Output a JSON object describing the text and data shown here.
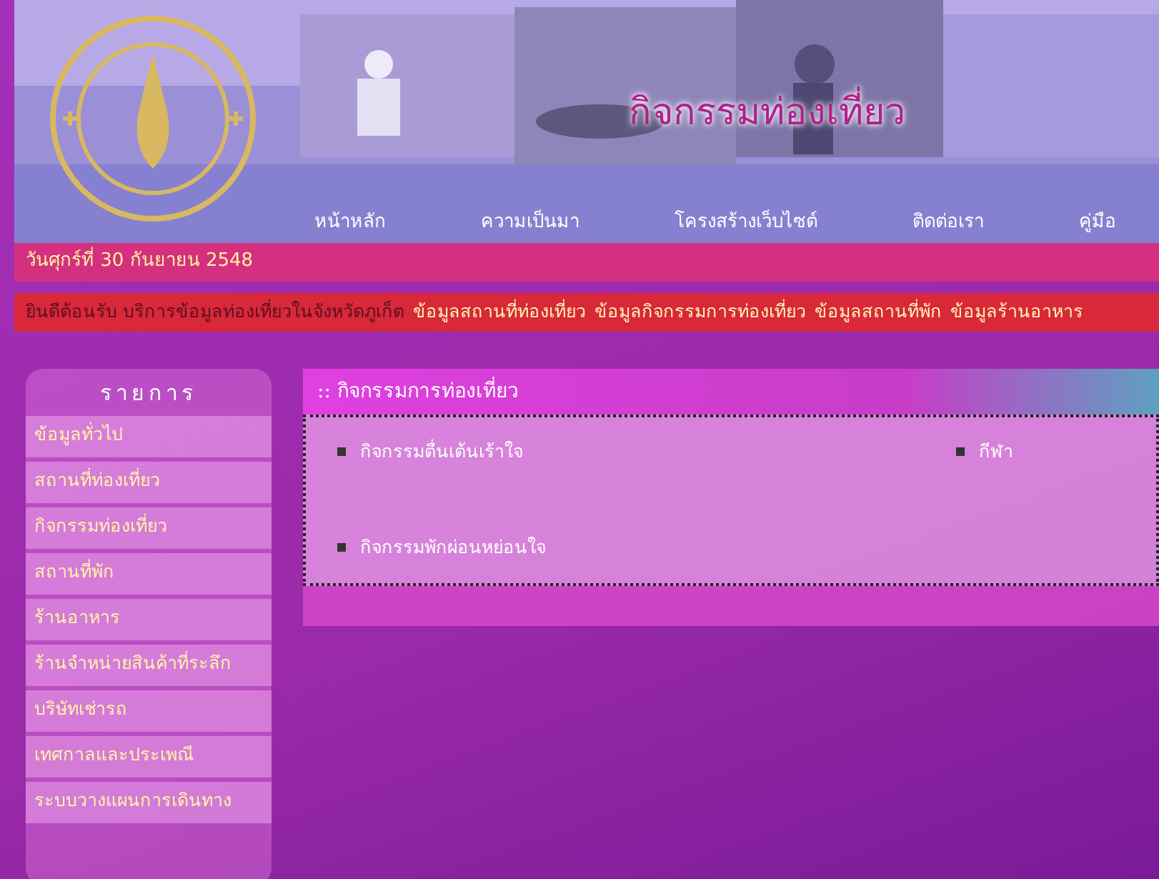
{
  "header": {
    "title": "กิจกรรมท่องเที่ยว",
    "nav": [
      {
        "label": "หน้าหลัก"
      },
      {
        "label": "ความเป็นมา"
      },
      {
        "label": "โครงสร้างเว็บไซต์"
      },
      {
        "label": "ติดต่อเรา"
      },
      {
        "label": "คู่มือ"
      }
    ]
  },
  "date": "วันศุกร์ที่ 30 กันยายน 2548",
  "ticker": {
    "welcome": "ยินดีต้อนรับ บริการข้อมูลท่องเที่ยวในจังหวัดภูเก็ต",
    "links": [
      "ข้อมูลสถานที่ท่องเที่ยว",
      "ข้อมูลกิจกรรมการท่องเที่ยว",
      "ข้อมูลสถานที่พัก",
      "ข้อมูลร้านอาหาร"
    ]
  },
  "sidebar": {
    "title": "รายการ",
    "items": [
      {
        "label": "ข้อมูลทั่วไป"
      },
      {
        "label": "สถานที่ท่องเที่ยว"
      },
      {
        "label": "กิจกรรมท่องเที่ยว"
      },
      {
        "label": "สถานที่พัก"
      },
      {
        "label": "ร้านอาหาร"
      },
      {
        "label": "ร้านจำหน่ายสินค้าที่ระลึก"
      },
      {
        "label": "บริษัทเช่ารถ"
      },
      {
        "label": "เทศกาลและประเพณี"
      },
      {
        "label": "ระบบวางแผนการเดินทาง"
      }
    ]
  },
  "content": {
    "title": ":: กิจกรรมการท่องเที่ยว",
    "items": [
      {
        "label": "กิจกรรมตื่นเต้นเร้าใจ"
      },
      {
        "label": "กีฬา"
      },
      {
        "label": "กิจกรรมพักผ่อนหย่อนใจ"
      }
    ]
  }
}
